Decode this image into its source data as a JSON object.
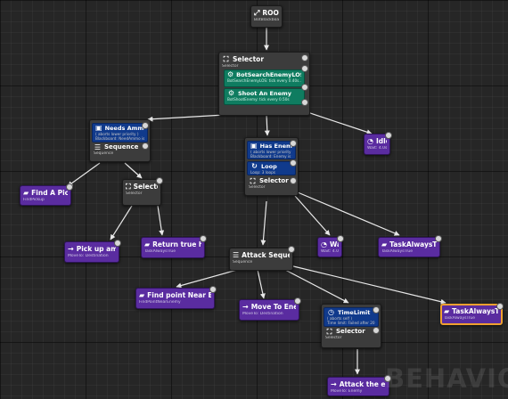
{
  "watermark": "BEHAVIOR",
  "root": {
    "title": "ROOT",
    "subtitle": "BotBlackboard",
    "icon": "root-icon"
  },
  "root_selector": {
    "title": "Selector",
    "subtitle": "Selector",
    "service1": {
      "title": "BotSearchEnemyLOS",
      "subtitle": "BotSearchEnemyLOS: tick every 0.40s..0.50s"
    },
    "service2": {
      "title": "Shoot An Enemy",
      "subtitle": "BotShootEnemy: tick every 0.50s"
    }
  },
  "needs_ammo_sequence": {
    "decorator_title": "Needs Ammo",
    "decorator_line1": "( aborts lower priority )",
    "decorator_line2": "Blackboard: NeedAmmo is Set",
    "title": "Sequence",
    "subtitle": "Sequence"
  },
  "has_enemy_selector": {
    "decorator1_title": "Has Enemy",
    "decorator1_line1": "( aborts lower priority )",
    "decorator1_line2": "Blackboard: Enemy is Set",
    "decorator2_title": "Loop",
    "decorator2_line1": "Loop: 3 loops",
    "title": "Selector",
    "subtitle": "Selector"
  },
  "idle": {
    "title": "Idle",
    "subtitle": "Wait: 4.0s"
  },
  "find_pickup": {
    "title": "Find A Pickup",
    "subtitle": "FindPickup"
  },
  "ammo_selector": {
    "title": "Selector",
    "subtitle": "Selector"
  },
  "pick_up_ammo": {
    "title": "Pick up ammo",
    "subtitle": "MoveTo: Destination"
  },
  "return_true_hack": {
    "title": "Return true hack",
    "subtitle": "TaskAlwaysTrue"
  },
  "attack_sequence": {
    "title": "Attack Sequence",
    "subtitle": "Sequence"
  },
  "wait": {
    "title": "Wait",
    "subtitle": "Wait: 4.0s"
  },
  "task_always_true_1": {
    "title": "TaskAlwaysTrue",
    "subtitle": "TaskAlwaysTrue"
  },
  "find_point_near_enemy": {
    "title": "Find point Near Enemy",
    "subtitle": "FindPointNearEnemy"
  },
  "move_to_enemy": {
    "title": "Move To Enemy",
    "subtitle": "MoveTo: Destination"
  },
  "time_limit_selector": {
    "decorator_title": "TimeLimit",
    "decorator_line1": "( aborts self )",
    "decorator_line2": "Time limit: Failed after 20.0s",
    "title": "Selector",
    "subtitle": "Selector"
  },
  "task_always_true_2": {
    "title": "TaskAlwaysTrue",
    "subtitle": "TaskAlwaysTrue",
    "selected": true
  },
  "attack_the_enemy": {
    "title": "Attack the enemy",
    "subtitle": "MoveTo: Enemy"
  },
  "colors": {
    "background": "#262626",
    "node_gray": "#3c3c3c",
    "task_purple": "#5a2ca0",
    "decorator_blue": "#103a8c",
    "service_green": "#0f7c60",
    "selection_orange": "#f0a030",
    "wire": "#e8e8e8"
  }
}
